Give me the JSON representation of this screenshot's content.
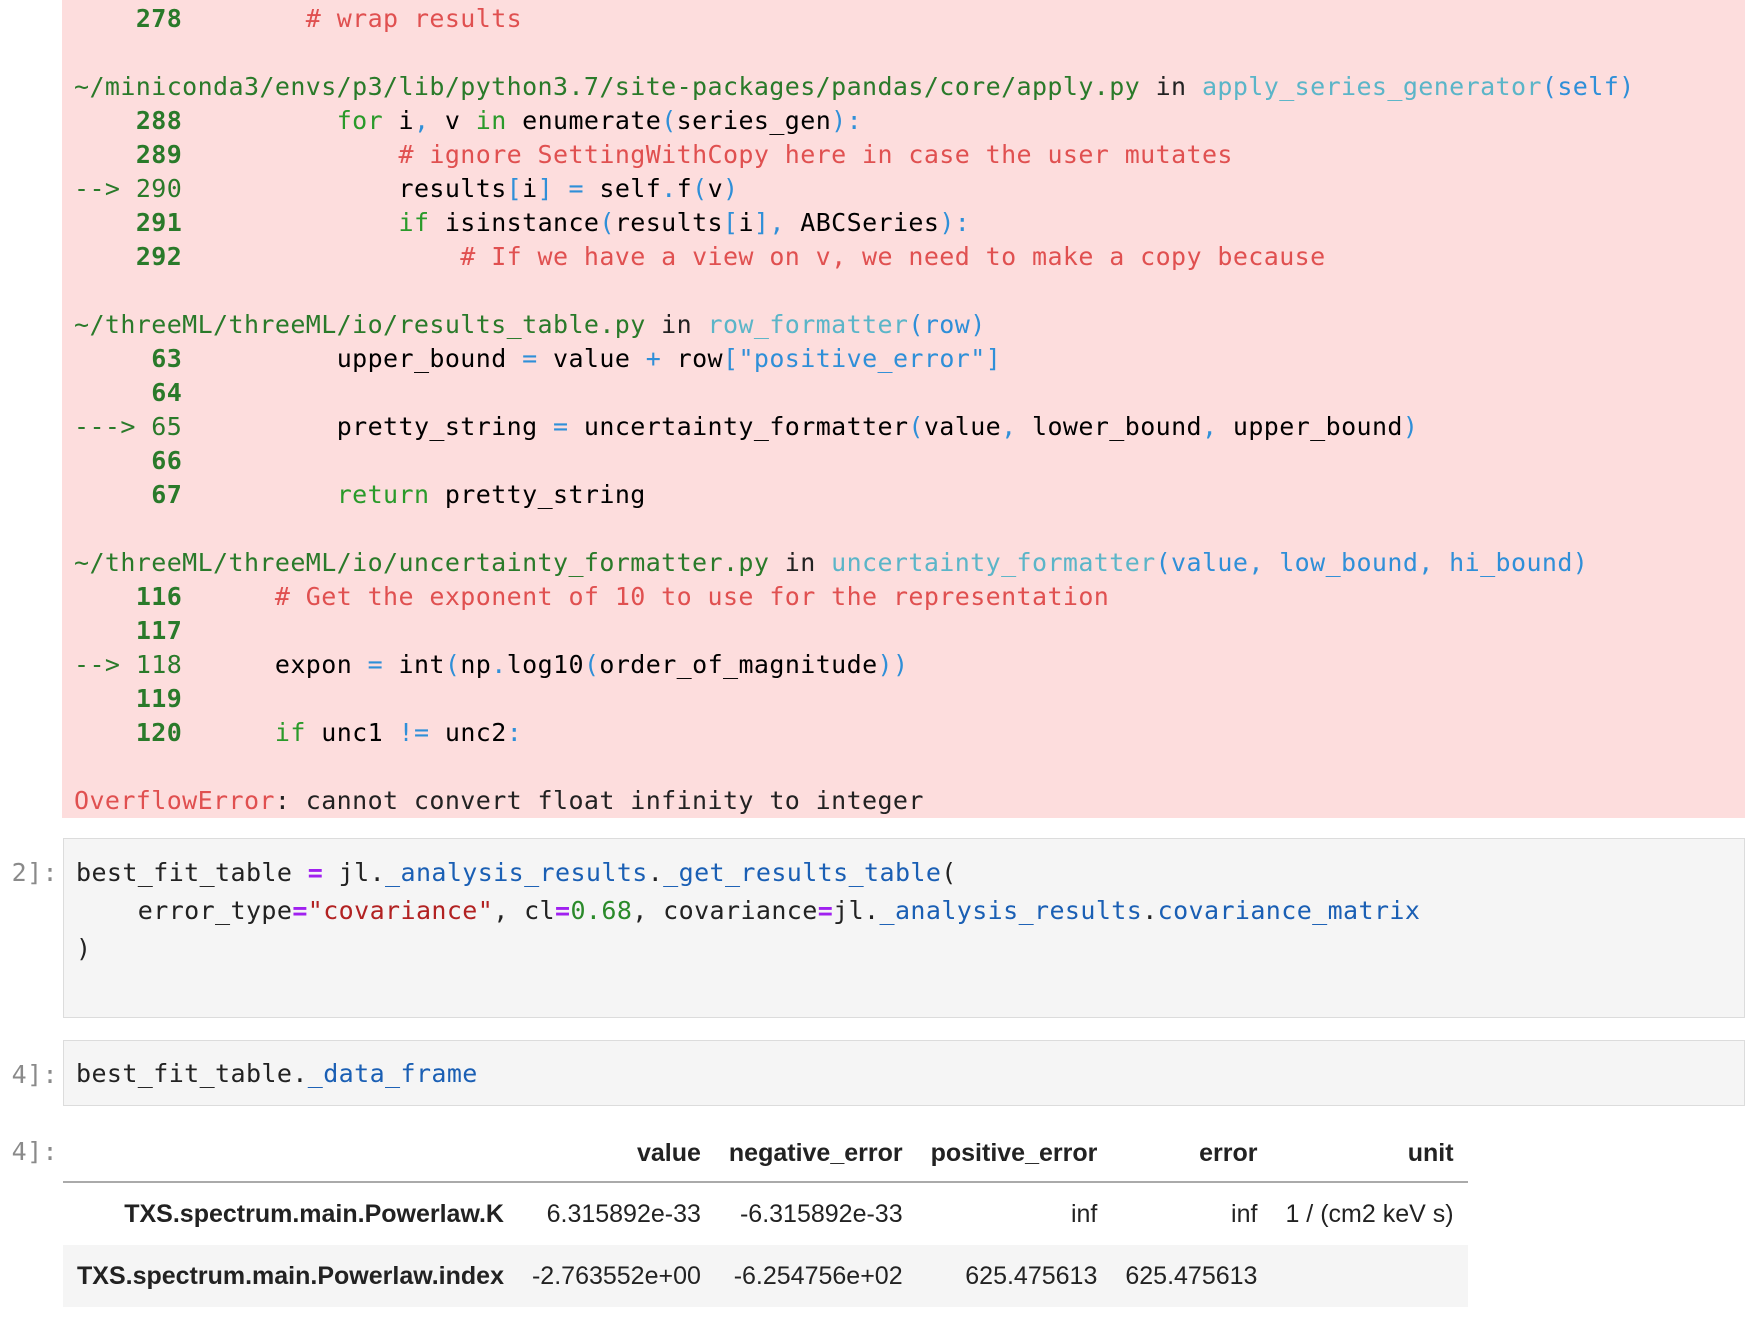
{
  "traceback": {
    "frame0": {
      "line278": {
        "num": "278",
        "comment": "# wrap results"
      }
    },
    "frame1": {
      "path": "~/miniconda3/envs/p3/lib/python3.7/site-packages/pandas/core/apply.py",
      "in_word": "in",
      "func": "apply_series_generator",
      "args": "(self)",
      "lines": [
        {
          "num": "288",
          "arrow": "",
          "code": "for i, v in enumerate(series_gen):"
        },
        {
          "num": "289",
          "arrow": "",
          "code": "# ignore SettingWithCopy here in case the user mutates"
        },
        {
          "num": "290",
          "arrow": "--> ",
          "code": "results[i] = self.f(v)"
        },
        {
          "num": "291",
          "arrow": "",
          "code": "if isinstance(results[i], ABCSeries):"
        },
        {
          "num": "292",
          "arrow": "",
          "code": "# If we have a view on v, we need to make a copy because"
        }
      ]
    },
    "frame2": {
      "path": "~/threeML/threeML/io/results_table.py",
      "in_word": "in",
      "func": "row_formatter",
      "args": "(row)",
      "lines": [
        {
          "num": "63",
          "arrow": "",
          "code": "upper_bound = value + row[\"positive_error\"]"
        },
        {
          "num": "64",
          "arrow": "",
          "code": ""
        },
        {
          "num": "65",
          "arrow": "---> ",
          "code": "pretty_string = uncertainty_formatter(value, lower_bound, upper_bound)"
        },
        {
          "num": "66",
          "arrow": "",
          "code": ""
        },
        {
          "num": "67",
          "arrow": "",
          "code": "return pretty_string"
        }
      ]
    },
    "frame3": {
      "path": "~/threeML/threeML/io/uncertainty_formatter.py",
      "in_word": "in",
      "func": "uncertainty_formatter",
      "args": "(value, low_bound, hi_bound)",
      "lines": [
        {
          "num": "116",
          "arrow": "",
          "code": "# Get the exponent of 10 to use for the representation"
        },
        {
          "num": "117",
          "arrow": "",
          "code": ""
        },
        {
          "num": "118",
          "arrow": "--> ",
          "code": "expon = int(np.log10(order_of_magnitude))"
        },
        {
          "num": "119",
          "arrow": "",
          "code": ""
        },
        {
          "num": "120",
          "arrow": "",
          "code": "if unc1 != unc2:"
        }
      ]
    },
    "error_name": "OverflowError",
    "error_msg": ": cannot convert float infinity to integer"
  },
  "cells": {
    "cell1": {
      "prompt": "2]:",
      "code_lines": [
        "best_fit_table = jl._analysis_results._get_results_table(",
        "    error_type=\"covariance\", cl=0.68, covariance=jl._analysis_results.covariance_matrix",
        ")"
      ]
    },
    "cell2": {
      "prompt": "4]:",
      "code": "best_fit_table._data_frame"
    },
    "output": {
      "prompt": "4]:"
    }
  },
  "table": {
    "columns": [
      "",
      "value",
      "negative_error",
      "positive_error",
      "error",
      "unit"
    ],
    "rows": [
      {
        "name": "TXS.spectrum.main.Powerlaw.K",
        "value": "6.315892e-33",
        "negative_error": "-6.315892e-33",
        "positive_error": "inf",
        "error": "inf",
        "unit": "1 / (cm2 keV s)"
      },
      {
        "name": "TXS.spectrum.main.Powerlaw.index",
        "value": "-2.763552e+00",
        "negative_error": "-6.254756e+02",
        "positive_error": "625.475613",
        "error": "625.475613",
        "unit": ""
      }
    ]
  }
}
